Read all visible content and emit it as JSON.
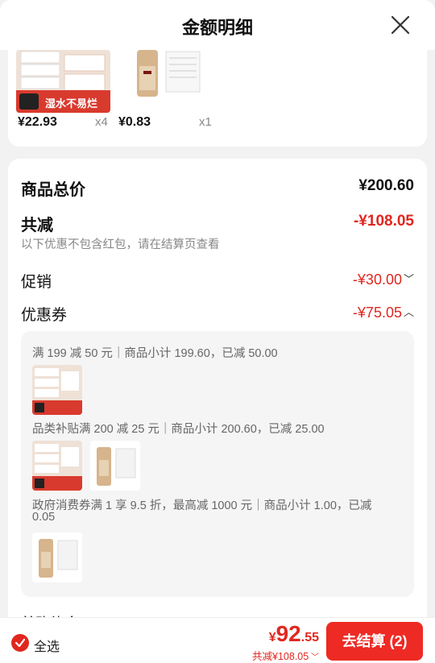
{
  "header": {
    "title": "金额明细",
    "close_icon": "close-icon"
  },
  "products": [
    {
      "price": "¥22.93",
      "qty": "x4",
      "image": "tissue-product-image",
      "banner": "湿水不易烂"
    },
    {
      "price": "¥0.83",
      "qty": "x1",
      "image": "shampoo-product-image"
    }
  ],
  "summary": {
    "total_label": "商品总价",
    "total_value": "¥200.60",
    "reduce_label": "共减",
    "reduce_value": "-¥108.05",
    "note": "以下优惠不包含红包，请在结算页查看",
    "promo_label": "促销",
    "promo_value": "-¥30.00",
    "coupon_label": "优惠券",
    "coupon_value": "-¥75.05"
  },
  "coupons": [
    {
      "text": "满 199 减 50 元｜商品小计 199.60，已减 50.00"
    },
    {
      "text": "品类补贴满 200 减 25 元｜商品小计 200.60，已减 25.00"
    },
    {
      "text": "政府消费券满 1 享 9.5 折，最高减 1000 元｜商品小计 1.00，已减",
      "text2": "0.05"
    }
  ],
  "partial_row": "首购礼金",
  "footer": {
    "select_all": "全选",
    "currency": "¥",
    "amount_int": "92",
    "amount_dec": ".55",
    "reduce_text": "共减¥108.05",
    "pay_button": "去结算 (2)"
  },
  "colors": {
    "accent": "#e0271f",
    "button": "#ee2a24"
  }
}
